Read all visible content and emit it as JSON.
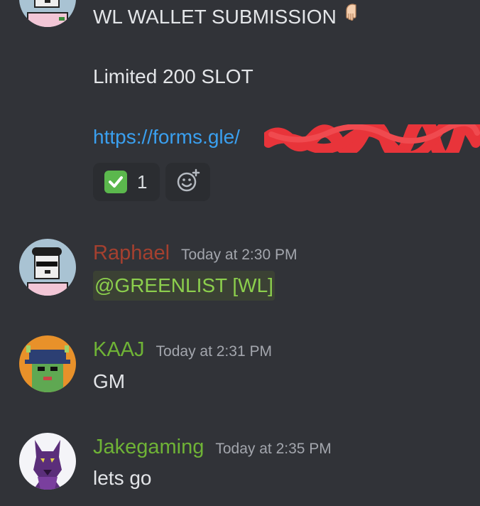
{
  "colors": {
    "background": "#313338",
    "reaction_bg": "#2b2d31",
    "link": "#3aa0f0",
    "username_raphael": "#a5402f",
    "username_green": "#6fb336",
    "timestamp": "#a3a6ad",
    "mention_text": "#8ccf4d",
    "mention_bg": "#3b4134",
    "redaction": "#e8343a"
  },
  "messages": [
    {
      "avatar": "pixel-dog-avatar",
      "lines": [
        "WL WALLET SUBMISSION",
        "Limited 200 SLOT"
      ],
      "pointer_emoji": "backhand-index-pointing-down",
      "link_text": "https://forms.gle/",
      "link_redacted": true,
      "reactions": [
        {
          "emoji": "white-check-mark",
          "count": "1"
        },
        {
          "emoji": "add-reaction-icon"
        }
      ]
    },
    {
      "avatar": "pixel-dog-beret-sunglasses-avatar",
      "username": "Raphael",
      "timestamp": "Today at 2:30 PM",
      "content": "@GREENLIST [WL]"
    },
    {
      "avatar": "green-monster-bucket-hat-avatar",
      "username": "KAAJ",
      "timestamp": "Today at 2:31 PM",
      "content": "GM"
    },
    {
      "avatar": "purple-wolf-avatar",
      "username": "Jakegaming",
      "timestamp": "Today at 2:35 PM",
      "content": "lets go"
    }
  ]
}
